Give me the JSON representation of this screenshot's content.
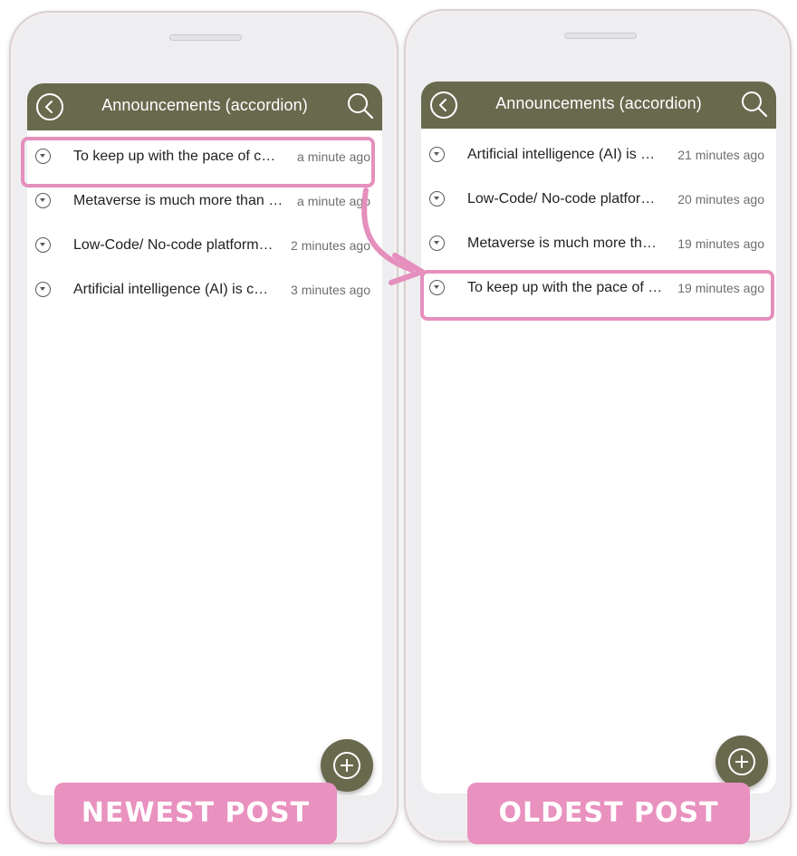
{
  "left_phone": {
    "header": {
      "title": "Announcements (accordion)"
    },
    "items": [
      {
        "title": "To keep up with the pace of change, companies need to",
        "time": "a minute ago"
      },
      {
        "title": "Metaverse is much more than a virtual world",
        "time": "a minute ago"
      },
      {
        "title": "Low-Code/ No-code platforms are on the rise",
        "time": "2 minutes ago"
      },
      {
        "title": "Artificial intelligence (AI) is changing everything",
        "time": "3 minutes ago"
      }
    ],
    "caption": "NEWEST POST"
  },
  "right_phone": {
    "header": {
      "title": "Announcements (accordion)"
    },
    "items": [
      {
        "title": "Artificial intelligence (AI) is changing everything",
        "time": "21 minutes ago"
      },
      {
        "title": "Low-Code/ No-code platforms are on the rise",
        "time": "20 minutes ago"
      },
      {
        "title": "Metaverse is much more than a virtual world",
        "time": "19 minutes ago"
      },
      {
        "title": "To keep up with the pace of change, companies need to",
        "time": "19 minutes ago"
      }
    ],
    "caption": "OLDEST POST"
  },
  "icons": {
    "back": "chevron-left-circle-icon",
    "search": "search-icon",
    "item": "chevron-down-circle-icon",
    "fab": "plus-circle-icon"
  },
  "colors": {
    "app_bar": "#69694e",
    "highlight": "#e58fbd",
    "caption_bg": "#e991bf"
  }
}
